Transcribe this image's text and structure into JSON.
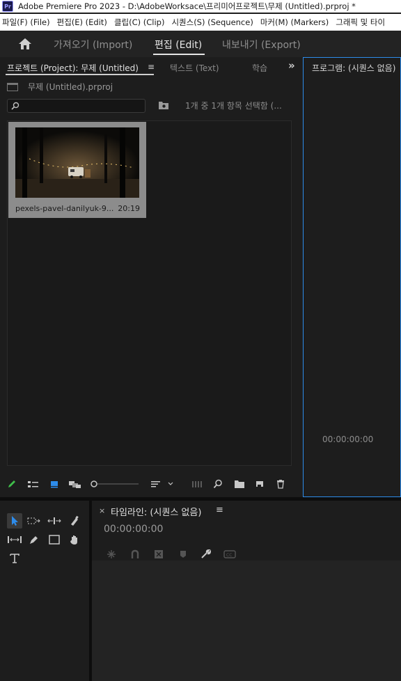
{
  "window": {
    "title": "Adobe Premiere Pro 2023 - D:\\AdobeWorksace\\프리미어프로젝트\\무제 (Untitled).prproj *",
    "app_icon_label": "Pr"
  },
  "menubar": {
    "items": [
      {
        "label": "파일(F) (File)"
      },
      {
        "label": "편집(E) (Edit)"
      },
      {
        "label": "클립(C) (Clip)"
      },
      {
        "label": "시퀀스(S) (Sequence)"
      },
      {
        "label": "마커(M) (Markers)"
      },
      {
        "label": "그래픽 및 타이"
      }
    ]
  },
  "workspace": {
    "tabs": [
      {
        "label": "가져오기 (Import)",
        "active": false
      },
      {
        "label": "편집 (Edit)",
        "active": true
      },
      {
        "label": "내보내기 (Export)",
        "active": false
      }
    ]
  },
  "project_panel": {
    "tabs": [
      {
        "label": "프로젝트 (Project): 무제 (Untitled)",
        "active": true
      },
      {
        "label": "텍스트 (Text)",
        "active": false
      },
      {
        "label": "학습",
        "active": false
      }
    ],
    "menu_glyph": "≡",
    "overflow_glyph": "»",
    "project_file": "무제 (Untitled).prproj",
    "search": {
      "value": "",
      "placeholder": ""
    },
    "selection_status": "1개 중 1개 항목 선택함 (...",
    "clips": [
      {
        "name": "pexels-pavel-danilyuk-9...",
        "duration": "20:19"
      }
    ]
  },
  "program_monitor": {
    "title": "프로그램: (시퀀스 없음)",
    "timecode": "00:00:00:00"
  },
  "timeline": {
    "close_glyph": "×",
    "title": "타임라인: (시퀀스 없음)",
    "menu_glyph": "≡",
    "timecode": "00:00:00:00"
  },
  "colors": {
    "accent_focus": "#2d8ceb",
    "panel_bg": "#1d1d1d",
    "selected_clip_bg": "#8c8c8c"
  },
  "icons": {
    "tools": [
      "selection-tool-icon",
      "track-select-icon",
      "ripple-edit-icon",
      "razor-icon",
      "slip-icon",
      "pen-icon",
      "rectangle-icon",
      "hand-icon",
      "type-icon"
    ],
    "project_toolbar": [
      "pencil-icon",
      "list-view-icon",
      "icon-view-icon",
      "freeform-view-icon",
      "zoom-slider",
      "sort-icon",
      "automate-icon",
      "find-icon",
      "new-bin-icon",
      "new-item-icon",
      "clear-icon"
    ],
    "timeline_toolbar": [
      "snap-icon",
      "linked-selection-icon",
      "add-marker-icon",
      "marker-icon",
      "settings-wrench-icon",
      "captions-icon"
    ]
  }
}
